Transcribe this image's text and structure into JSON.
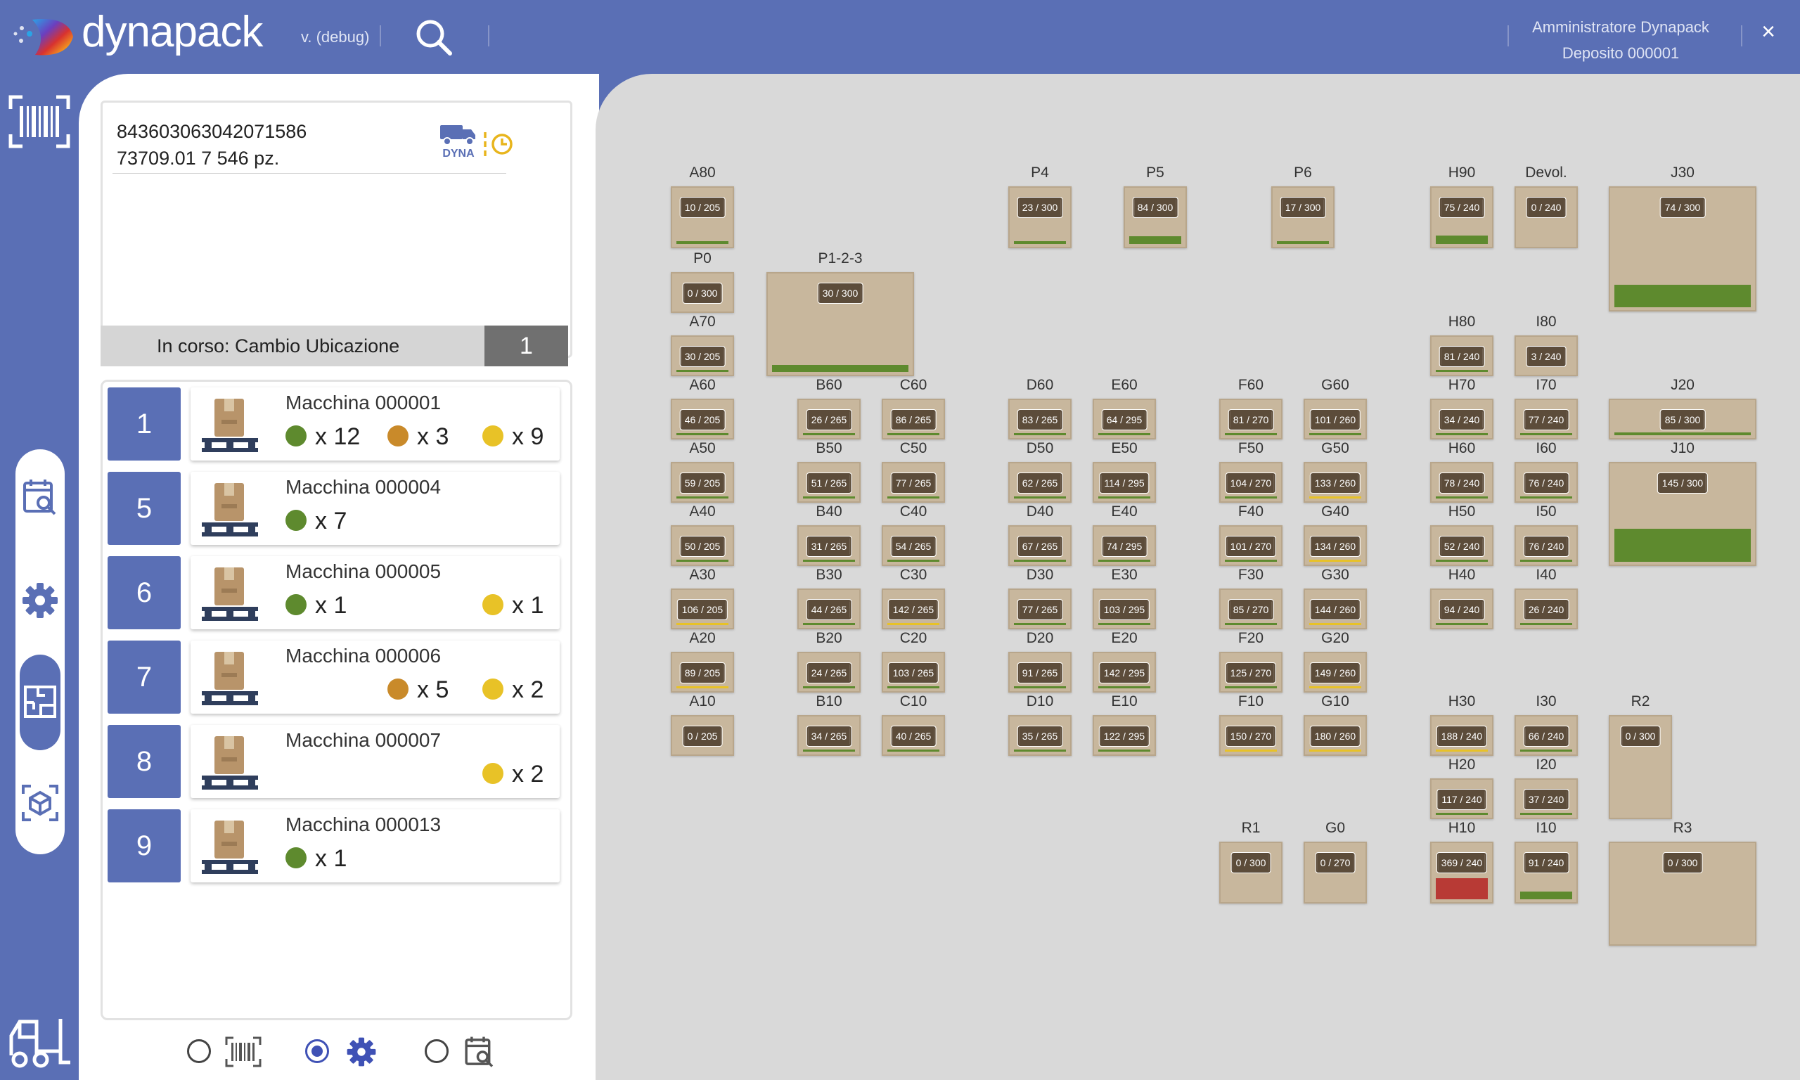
{
  "header": {
    "app_name": "dynapack",
    "version": "v. (debug)",
    "user_name": "Amministratore Dynapack",
    "warehouse": "Deposito 000001",
    "close_glyph": "×"
  },
  "sidebar": {
    "icons": [
      "barcode-icon",
      "calendar-search-icon",
      "gear-icon",
      "floorplan-icon",
      "box-3d-icon",
      "forklift-icon"
    ],
    "active": "floorplan-icon"
  },
  "scan": {
    "code_line": "843603063042071586",
    "info_line": "73709.01 7 546 pz.",
    "truck_badge": "DYNA",
    "status_label": "In corso:  Cambio Ubicazione",
    "status_count": "1"
  },
  "queue": [
    {
      "num": "1",
      "name": "Macchina 000001",
      "chips": [
        {
          "color": "green",
          "qty": "x 12"
        },
        {
          "color": "orange",
          "qty": "x 3"
        },
        {
          "color": "yellow",
          "qty": "x 9"
        }
      ]
    },
    {
      "num": "5",
      "name": "Macchina 000004",
      "chips": [
        {
          "color": "green",
          "qty": "x 7"
        }
      ]
    },
    {
      "num": "6",
      "name": "Macchina 000005",
      "chips": [
        {
          "color": "green",
          "qty": "x 1"
        },
        {
          "color": "yellow",
          "qty": "x 1"
        }
      ]
    },
    {
      "num": "7",
      "name": "Macchina 000006",
      "chips": [
        {
          "color": "orange",
          "qty": "x 5"
        },
        {
          "color": "yellow",
          "qty": "x 2"
        }
      ]
    },
    {
      "num": "8",
      "name": "Macchina 000007",
      "chips": [
        {
          "color": "yellow",
          "qty": "x 2"
        }
      ]
    },
    {
      "num": "9",
      "name": "Macchina 000013",
      "chips": [
        {
          "color": "green",
          "qty": "x 1"
        }
      ]
    }
  ],
  "colors": {
    "brand": "#5a6fb5",
    "green": "#5e8a2e",
    "orange": "#c98a2a",
    "yellow": "#e8c227",
    "red": "#b83a35",
    "box": "#c8b79d"
  },
  "bottom_modes": [
    {
      "icon": "barcode-icon",
      "selected": false
    },
    {
      "icon": "gear-icon",
      "selected": true
    },
    {
      "icon": "calendar-search-icon",
      "selected": false
    }
  ],
  "locations": [
    {
      "name": "A80",
      "fill": "10 / 205",
      "level": 0.05,
      "line": "green"
    },
    {
      "name": "P0",
      "fill": "0 / 300",
      "level": 0,
      "line": ""
    },
    {
      "name": "A70",
      "fill": "30 / 205",
      "level": 0,
      "line": "green"
    },
    {
      "name": "A60",
      "fill": "46 / 205",
      "level": 0,
      "line": "green"
    },
    {
      "name": "A50",
      "fill": "59 / 205",
      "level": 0,
      "line": "green"
    },
    {
      "name": "A40",
      "fill": "50 / 205",
      "level": 0,
      "line": "green"
    },
    {
      "name": "A30",
      "fill": "106 / 205",
      "level": 0,
      "line": "yellow"
    },
    {
      "name": "A20",
      "fill": "89 / 205",
      "level": 0,
      "line": "yellow"
    },
    {
      "name": "A10",
      "fill": "0 / 205",
      "level": 0,
      "line": ""
    },
    {
      "name": "P1-2-3",
      "fill": "30 / 300",
      "level": 0.1,
      "line": "green"
    },
    {
      "name": "B60",
      "fill": "26 / 265",
      "level": 0,
      "line": "green"
    },
    {
      "name": "C60",
      "fill": "86 / 265",
      "level": 0,
      "line": "green"
    },
    {
      "name": "B50",
      "fill": "51 / 265",
      "level": 0,
      "line": "green"
    },
    {
      "name": "C50",
      "fill": "77 / 265",
      "level": 0,
      "line": "green"
    },
    {
      "name": "B40",
      "fill": "31 / 265",
      "level": 0,
      "line": "green"
    },
    {
      "name": "C40",
      "fill": "54 / 265",
      "level": 0,
      "line": "green"
    },
    {
      "name": "B30",
      "fill": "44 / 265",
      "level": 0,
      "line": "green"
    },
    {
      "name": "C30",
      "fill": "142 / 265",
      "level": 0,
      "line": "yellow"
    },
    {
      "name": "B20",
      "fill": "24 / 265",
      "level": 0,
      "line": "green"
    },
    {
      "name": "C20",
      "fill": "103 / 265",
      "level": 0,
      "line": "green"
    },
    {
      "name": "B10",
      "fill": "34 / 265",
      "level": 0,
      "line": "green"
    },
    {
      "name": "C10",
      "fill": "40 / 265",
      "level": 0,
      "line": "green"
    },
    {
      "name": "P4",
      "fill": "23 / 300",
      "level": 0.05,
      "line": "green"
    },
    {
      "name": "D60",
      "fill": "83 / 265",
      "level": 0,
      "line": "green"
    },
    {
      "name": "E60",
      "fill": "64 / 295",
      "level": 0,
      "line": "green"
    },
    {
      "name": "D50",
      "fill": "62 / 265",
      "level": 0,
      "line": "green"
    },
    {
      "name": "E50",
      "fill": "114 / 295",
      "level": 0,
      "line": "green"
    },
    {
      "name": "D40",
      "fill": "67 / 265",
      "level": 0,
      "line": "green"
    },
    {
      "name": "E40",
      "fill": "74 / 295",
      "level": 0,
      "line": "green"
    },
    {
      "name": "D30",
      "fill": "77 / 265",
      "level": 0,
      "line": "green"
    },
    {
      "name": "E30",
      "fill": "103 / 295",
      "level": 0,
      "line": "green"
    },
    {
      "name": "D20",
      "fill": "91 / 265",
      "level": 0,
      "line": "green"
    },
    {
      "name": "E20",
      "fill": "142 / 295",
      "level": 0,
      "line": "green"
    },
    {
      "name": "D10",
      "fill": "35 / 265",
      "level": 0,
      "line": "green"
    },
    {
      "name": "E10",
      "fill": "122 / 295",
      "level": 0,
      "line": "green"
    },
    {
      "name": "P5",
      "fill": "84 / 300",
      "level": 0.28,
      "line": "green"
    },
    {
      "name": "P6",
      "fill": "17 / 300",
      "level": 0.05,
      "line": "green"
    },
    {
      "name": "F60",
      "fill": "81 / 270",
      "level": 0,
      "line": "green"
    },
    {
      "name": "G60",
      "fill": "101 / 260",
      "level": 0,
      "line": "green"
    },
    {
      "name": "F50",
      "fill": "104 / 270",
      "level": 0,
      "line": "green"
    },
    {
      "name": "G50",
      "fill": "133 / 260",
      "level": 0,
      "line": "yellow"
    },
    {
      "name": "F40",
      "fill": "101 / 270",
      "level": 0,
      "line": "green"
    },
    {
      "name": "G40",
      "fill": "134 / 260",
      "level": 0,
      "line": "yellow"
    },
    {
      "name": "F30",
      "fill": "85 / 270",
      "level": 0,
      "line": "green"
    },
    {
      "name": "G30",
      "fill": "144 / 260",
      "level": 0,
      "line": "yellow"
    },
    {
      "name": "F20",
      "fill": "125 / 270",
      "level": 0,
      "line": "green"
    },
    {
      "name": "G20",
      "fill": "149 / 260",
      "level": 0,
      "line": "yellow"
    },
    {
      "name": "F10",
      "fill": "150 / 270",
      "level": 0,
      "line": "yellow"
    },
    {
      "name": "G10",
      "fill": "180 / 260",
      "level": 0,
      "line": "yellow"
    },
    {
      "name": "R1",
      "fill": "0 / 300",
      "level": 0,
      "line": ""
    },
    {
      "name": "G0",
      "fill": "0 / 270",
      "level": 0,
      "line": ""
    },
    {
      "name": "H90",
      "fill": "75 / 240",
      "level": 0.31,
      "line": "green"
    },
    {
      "name": "Devol.",
      "fill": "0 / 240",
      "level": 0,
      "line": ""
    },
    {
      "name": "H80",
      "fill": "81 / 240",
      "level": 0,
      "line": "green"
    },
    {
      "name": "I80",
      "fill": "3 / 240",
      "level": 0,
      "line": ""
    },
    {
      "name": "H70",
      "fill": "34 / 240",
      "level": 0,
      "line": "green"
    },
    {
      "name": "I70",
      "fill": "77 / 240",
      "level": 0,
      "line": "green"
    },
    {
      "name": "H60",
      "fill": "78 / 240",
      "level": 0,
      "line": "green"
    },
    {
      "name": "I60",
      "fill": "76 / 240",
      "level": 0,
      "line": "green"
    },
    {
      "name": "H50",
      "fill": "52 / 240",
      "level": 0,
      "line": "green"
    },
    {
      "name": "I50",
      "fill": "76 / 240",
      "level": 0,
      "line": "green"
    },
    {
      "name": "H40",
      "fill": "94 / 240",
      "level": 0,
      "line": "green"
    },
    {
      "name": "I40",
      "fill": "26 / 240",
      "level": 0,
      "line": "green"
    },
    {
      "name": "H30",
      "fill": "188 / 240",
      "level": 0,
      "line": "yellow"
    },
    {
      "name": "I30",
      "fill": "66 / 240",
      "level": 0,
      "line": "green"
    },
    {
      "name": "H20",
      "fill": "117 / 240",
      "level": 0,
      "line": "green"
    },
    {
      "name": "I20",
      "fill": "37 / 240",
      "level": 0,
      "line": "green"
    },
    {
      "name": "H10",
      "fill": "369 / 240",
      "level": 0.8,
      "line": "red"
    },
    {
      "name": "I10",
      "fill": "91 / 240",
      "level": 0.3,
      "line": "green"
    },
    {
      "name": "J30",
      "fill": "74 / 300",
      "level": 0.25,
      "line": "green"
    },
    {
      "name": "J20",
      "fill": "85 / 300",
      "level": 0.28,
      "line": "green"
    },
    {
      "name": "J10",
      "fill": "145 / 300",
      "level": 0.48,
      "line": "green"
    },
    {
      "name": "R2",
      "fill": "0 / 300",
      "level": 0,
      "line": ""
    },
    {
      "name": "R3",
      "fill": "0 / 300",
      "level": 0,
      "line": ""
    }
  ]
}
